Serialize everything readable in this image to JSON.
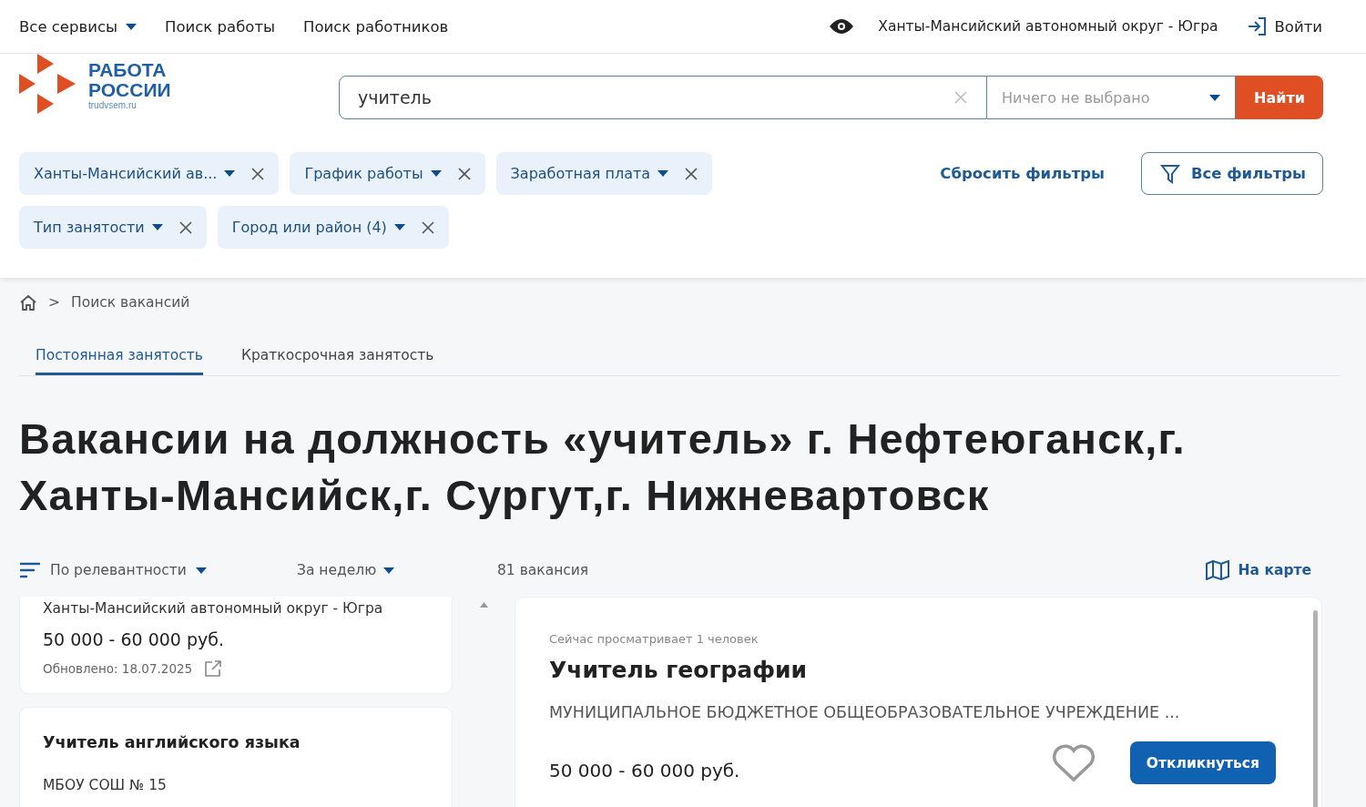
{
  "top_nav": {
    "items": [
      {
        "label": "Все сервисы",
        "dropdown": true
      },
      {
        "label": "Поиск работы",
        "dropdown": false
      },
      {
        "label": "Поиск работников",
        "dropdown": false
      }
    ],
    "region": "Ханты-Мансийский автономный округ - Югра",
    "login": "Войти"
  },
  "logo": {
    "line1": "РАБОТА",
    "line2": "РОССИИ",
    "domain": "trudvsem.ru"
  },
  "search": {
    "value": "учитель",
    "category_placeholder": "Ничего не выбрано",
    "submit": "Найти"
  },
  "filters": [
    {
      "label": "Ханты-Мансийский ав..."
    },
    {
      "label": "График работы"
    },
    {
      "label": "Заработная плата"
    },
    {
      "label": "Тип занятости"
    },
    {
      "label": "Город или район (4)"
    }
  ],
  "reset_filters": "Сбросить фильтры",
  "all_filters": "Все фильтры",
  "breadcrumb": {
    "separator": ">",
    "items": [
      "Поиск вакансий"
    ]
  },
  "tabs": [
    {
      "label": "Постоянная занятость",
      "selected": true
    },
    {
      "label": "Краткосрочная занятость",
      "selected": false
    }
  ],
  "heading": "Вакансии на должность «учитель» г. Нефтеюганск,г. Ханты-Мансийск,г. Сургут,г. Нижневартовск",
  "sort": "По релевантности",
  "period": "За неделю",
  "count": "81 вакансия",
  "map_link": "На карте",
  "list": [
    {
      "kind": "partial",
      "region": "Ханты-Мансийский автономный округ - Югра",
      "salary": "50 000 - 60 000 руб.",
      "updated": "Обновлено: 18.07.2025"
    },
    {
      "kind": "full",
      "title": "Учитель английского языка",
      "employer": "МБОУ СОШ № 15"
    }
  ],
  "detail": {
    "viewers": "Сейчас просматривает 1 человек",
    "title": "Учитель географии",
    "employer": "МУНИЦИПАЛЬНОЕ БЮДЖЕТНОЕ ОБЩЕОБРАЗОВАТЕЛЬНОЕ УЧРЕЖДЕНИЕ ...",
    "salary": "50 000 - 60 000 руб.",
    "favorite": false,
    "apply": "Откликнуться"
  }
}
